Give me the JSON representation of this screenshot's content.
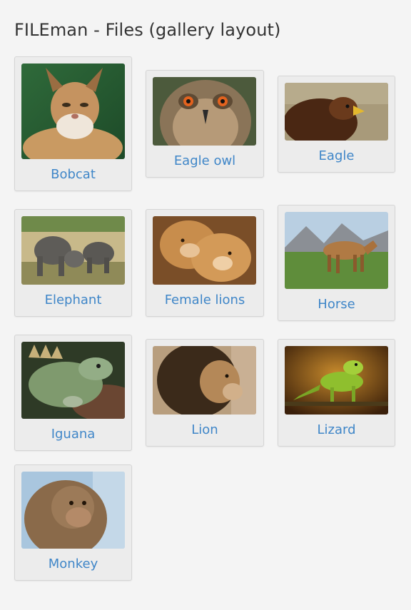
{
  "page": {
    "title": "FILEman - Files (gallery layout)"
  },
  "colors": {
    "background": "#f4f4f4",
    "card_background": "#ececec",
    "card_border": "#d5d5d5",
    "link": "#3f86c8",
    "title_text": "#333333"
  },
  "files": [
    {
      "name": "Bobcat"
    },
    {
      "name": "Eagle owl"
    },
    {
      "name": "Eagle"
    },
    {
      "name": "Elephant"
    },
    {
      "name": "Female lions"
    },
    {
      "name": "Horse"
    },
    {
      "name": "Iguana"
    },
    {
      "name": "Lion"
    },
    {
      "name": "Lizard"
    },
    {
      "name": "Monkey"
    }
  ]
}
